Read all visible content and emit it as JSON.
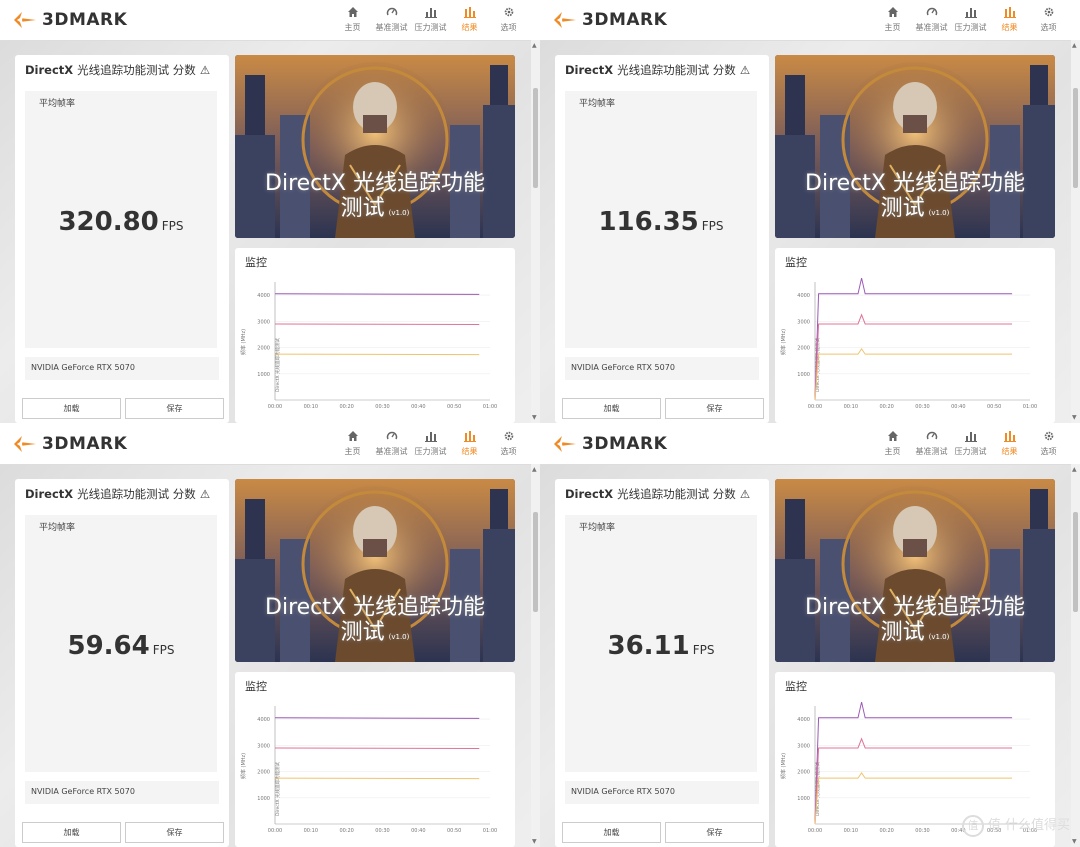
{
  "app": {
    "logo_text": "3DMARK"
  },
  "nav": [
    {
      "label": "主页",
      "icon": "home-icon"
    },
    {
      "label": "基准测试",
      "icon": "gauge-icon"
    },
    {
      "label": "压力测试",
      "icon": "stress-bars-icon"
    },
    {
      "label": "结果",
      "icon": "results-bars-icon",
      "active": true
    },
    {
      "label": "选项",
      "icon": "gear-icon"
    }
  ],
  "score_card": {
    "title_prefix": "DirectX",
    "title_cn": "光线追踪功能测试 分数",
    "warning_icon": "warning-icon",
    "avg_label": "平均帧率",
    "unit": "FPS",
    "gpu": "NVIDIA GeForce RTX 5070",
    "load_label": "加载",
    "save_label": "保存"
  },
  "hero": {
    "title_line1": "DirectX 光线追踪功能",
    "title_line2": "测试",
    "version": "(v1.0)"
  },
  "monitor": {
    "title": "监控",
    "y_axis_label": "频率 (MHz)",
    "vertical_label": "DirectX 光线追踪功能测试",
    "x_ticks": [
      "00:00",
      "00:10",
      "00:20",
      "00:30",
      "00:40",
      "00:50",
      "01:00"
    ],
    "y_ticks": [
      "1000",
      "2000",
      "3000",
      "4000"
    ]
  },
  "colors": {
    "purple": "#9b59b6",
    "pink": "#e0739b",
    "yellow": "#f0c36d",
    "accent": "#f08a24"
  },
  "panels": [
    {
      "fps": "320.80",
      "spike": false
    },
    {
      "fps": "116.35",
      "spike": true
    },
    {
      "fps": "59.64",
      "spike": false
    },
    {
      "fps": "36.11",
      "spike": true
    }
  ],
  "watermark": "值 什么值得买"
}
